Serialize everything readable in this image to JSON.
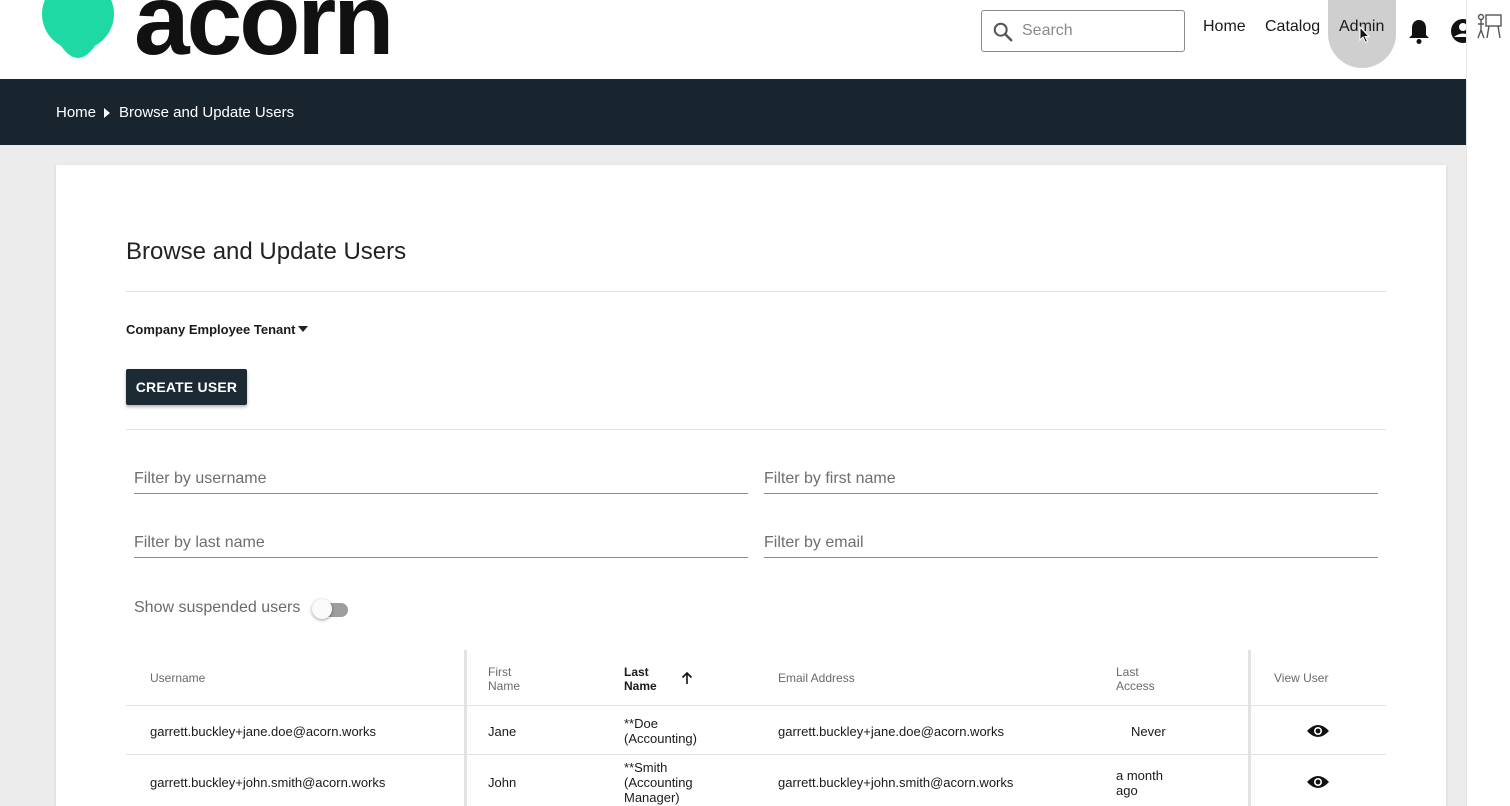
{
  "brand": {
    "name": "acorn",
    "accent": "#1ed9a4"
  },
  "header": {
    "search_placeholder": "Search",
    "nav": {
      "home": "Home",
      "catalog": "Catalog",
      "admin": "Admin"
    }
  },
  "breadcrumb": {
    "home": "Home",
    "current": "Browse and Update Users"
  },
  "page": {
    "title": "Browse and Update Users",
    "tenant": "Company Employee Tenant",
    "create_user": "CREATE USER",
    "filters": {
      "username": "Filter by username",
      "first_name": "Filter by first name",
      "last_name": "Filter by last name",
      "email": "Filter by email"
    },
    "show_suspended": "Show suspended users"
  },
  "table": {
    "headers": {
      "username": "Username",
      "first_name_1": "First",
      "first_name_2": "Name",
      "last_name_1": "Last",
      "last_name_2": "Name",
      "email": "Email Address",
      "last_access_1": "Last",
      "last_access_2": "Access",
      "view_user": "View User"
    },
    "rows": [
      {
        "username": "garrett.buckley+jane.doe@acorn.works",
        "first_name": "Jane",
        "last_name_1": "**Doe",
        "last_name_2": "(Accounting)",
        "last_name_3": "",
        "email": "garrett.buckley+jane.doe@acorn.works",
        "last_access_1": "Never",
        "last_access_2": ""
      },
      {
        "username": "garrett.buckley+john.smith@acorn.works",
        "first_name": "John",
        "last_name_1": "**Smith",
        "last_name_2": "(Accounting",
        "last_name_3": "Manager)",
        "email": "garrett.buckley+john.smith@acorn.works",
        "last_access_1": "a month",
        "last_access_2": "ago"
      }
    ]
  }
}
